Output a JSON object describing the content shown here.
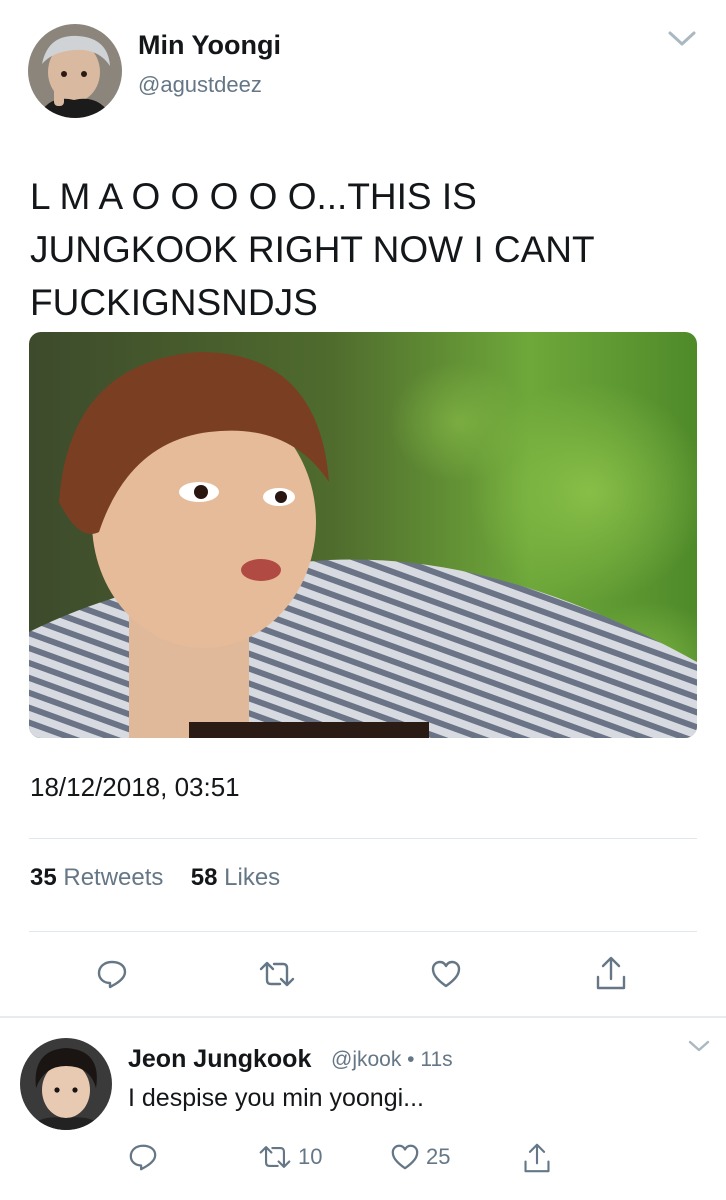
{
  "tweet": {
    "display_name": "Min Yoongi",
    "handle": "@agustdeez",
    "text_lines": [
      "L M A O O O O O...THIS IS",
      "JUNGKOOK RIGHT NOW I CANT",
      "FUCKIGNSNDJS"
    ],
    "timestamp": "18/12/2018, 03:51",
    "retweet_count": "35",
    "retweet_label": "Retweets",
    "like_count": "58",
    "like_label": "Likes",
    "actions": [
      "reply-icon",
      "retweet-icon",
      "like-icon",
      "share-icon"
    ]
  },
  "reply": {
    "display_name": "Jeon Jungkook",
    "meta": "@jkook • 11s",
    "text": "I despise you min yoongi...",
    "retweet_count": "10",
    "like_count": "25",
    "actions": [
      "reply-icon",
      "retweet-icon",
      "like-icon",
      "share-icon"
    ]
  },
  "colors": {
    "text": "#14171a",
    "secondary": "#657786",
    "divider": "#e1e8ed",
    "icon": "#657786"
  }
}
